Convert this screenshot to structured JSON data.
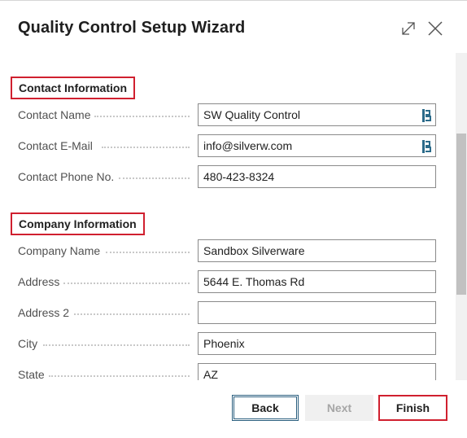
{
  "dialog": {
    "title": "Quality Control Setup Wizard"
  },
  "sections": {
    "contact": {
      "header": "Contact Information",
      "fields": [
        {
          "label": "Contact Name",
          "value": "SW Quality Control",
          "has_lookup": true
        },
        {
          "label": "Contact E-Mail",
          "value": "info@silverw.com",
          "has_lookup": true
        },
        {
          "label": "Contact Phone No.",
          "value": "480-423-8324",
          "has_lookup": false
        }
      ]
    },
    "company": {
      "header": "Company Information",
      "fields": [
        {
          "label": "Company Name",
          "value": "Sandbox Silverware"
        },
        {
          "label": "Address",
          "value": "5644 E. Thomas Rd"
        },
        {
          "label": "Address 2",
          "value": ""
        },
        {
          "label": "City",
          "value": "Phoenix"
        },
        {
          "label": "State",
          "value": "AZ"
        }
      ]
    }
  },
  "footer": {
    "back_label": "Back",
    "next_label": "Next",
    "finish_label": "Finish"
  },
  "icons": {
    "expand": "expand-icon",
    "close": "close-icon",
    "lookup": "lookup-icon"
  },
  "colors": {
    "highlight_border": "#d0202f",
    "back_button_border": "#2b5f7f",
    "lookup_icon": "#2b6b8a"
  }
}
